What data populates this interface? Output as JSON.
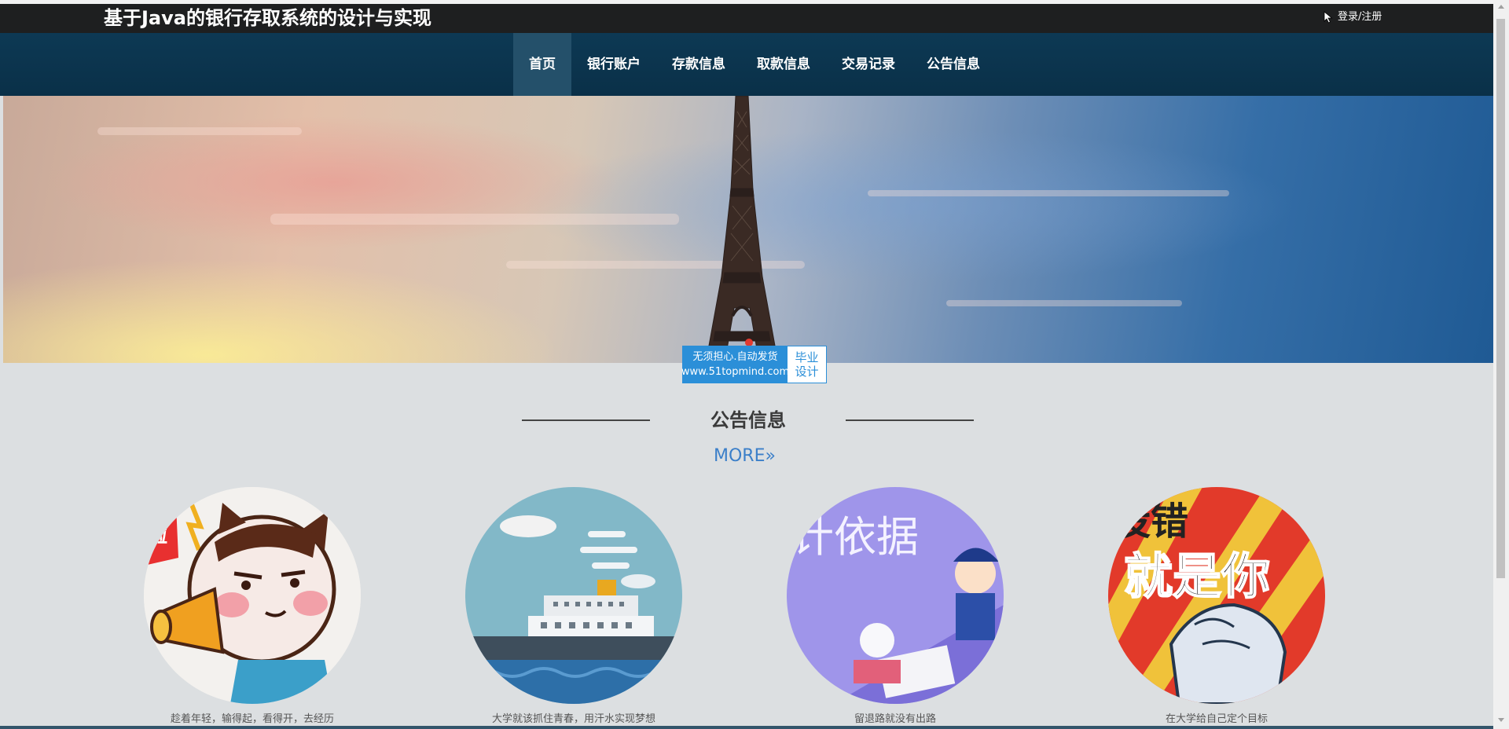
{
  "header": {
    "title": "基于Java的银行存取系统的设计与实现",
    "login": "登录/注册"
  },
  "nav": {
    "items": [
      "首页",
      "银行账户",
      "存款信息",
      "取款信息",
      "交易记录",
      "公告信息"
    ],
    "active_index": 0
  },
  "banner": {
    "dot_color": "#e13a31"
  },
  "ad": {
    "line1": "无须担心.自动发货",
    "line2": "www.51topmind.com",
    "right1": "毕业",
    "right2": "设计"
  },
  "section": {
    "title": "公告信息",
    "more": "MORE»"
  },
  "cards": [
    {
      "caption": "趁着年轻，输得起，看得开，去经历",
      "image_text": "啦"
    },
    {
      "caption": "大学就该抓住青春，用汗水实现梦想",
      "image_text": ""
    },
    {
      "caption": "留退路就没有出路",
      "image_text": "计依据"
    },
    {
      "caption": "在大学给自己定个目标",
      "image_text": "就是你"
    }
  ],
  "colors": {
    "topbar": "#1e1f20",
    "navbar": "#0d3954",
    "nav_active": "#24506a",
    "accent": "#3b7fc9"
  }
}
